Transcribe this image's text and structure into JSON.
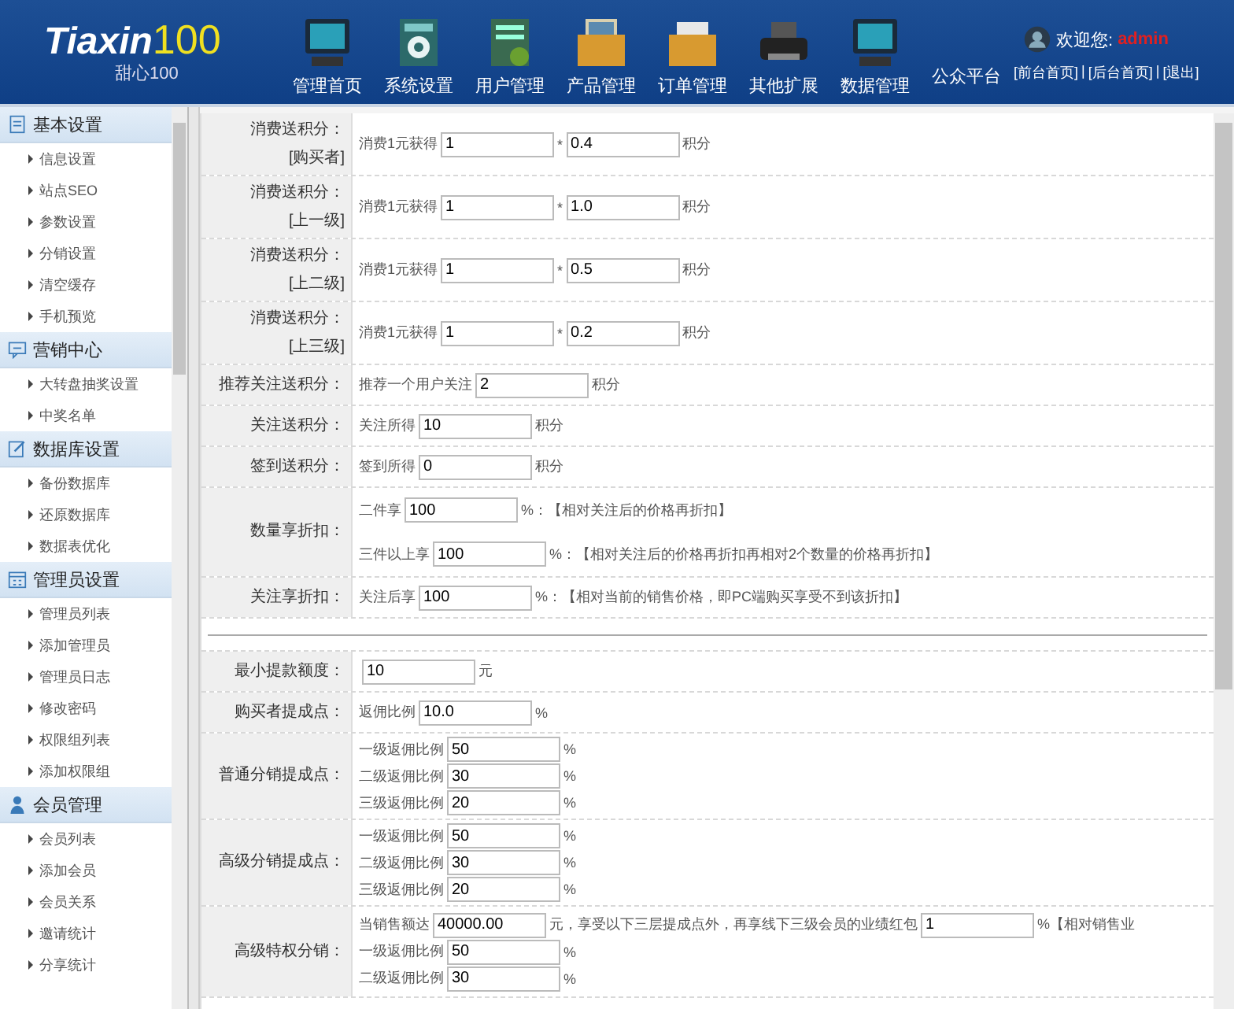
{
  "header": {
    "logo": {
      "name": "Tiaxin",
      "number": "100",
      "subtitle": "甜心100"
    },
    "nav": [
      {
        "label": "管理首页"
      },
      {
        "label": "系统设置"
      },
      {
        "label": "用户管理"
      },
      {
        "label": "产品管理"
      },
      {
        "label": "订单管理"
      },
      {
        "label": "其他扩展"
      },
      {
        "label": "数据管理"
      },
      {
        "label": "公众平台"
      }
    ],
    "welcome": {
      "label": "欢迎您:",
      "user": "admin"
    },
    "links": [
      {
        "label": "[前台首页]",
        "sep": "|"
      },
      {
        "label": "[后台首页]",
        "sep": "|"
      },
      {
        "label": "[退出]"
      }
    ]
  },
  "sidebar": [
    {
      "title": "基本设置",
      "items": [
        "信息设置",
        "站点SEO",
        "参数设置",
        "分销设置",
        "清空缓存",
        "手机预览"
      ]
    },
    {
      "title": "营销中心",
      "items": [
        "大转盘抽奖设置",
        "中奖名单"
      ]
    },
    {
      "title": "数据库设置",
      "items": [
        "备份数据库",
        "还原数据库",
        "数据表优化"
      ]
    },
    {
      "title": "管理员设置",
      "items": [
        "管理员列表",
        "添加管理员",
        "管理员日志",
        "修改密码",
        "权限组列表",
        "添加权限组"
      ]
    },
    {
      "title": "会员管理",
      "items": [
        "会员列表",
        "添加会员",
        "会员关系",
        "邀请统计",
        "分享统计"
      ]
    }
  ],
  "form": [
    {
      "kind": "tall",
      "label": [
        "消费送积分：",
        "[购买者]"
      ],
      "lines": [
        [
          {
            "kind": "text",
            "text": "消费1元获得"
          },
          {
            "kind": "input",
            "value": "1"
          },
          {
            "kind": "text",
            "text": "*"
          },
          {
            "kind": "input",
            "value": "0.4"
          },
          {
            "kind": "text",
            "text": "积分"
          }
        ]
      ]
    },
    {
      "kind": "tall",
      "label": [
        "消费送积分：",
        "[上一级]"
      ],
      "lines": [
        [
          {
            "kind": "text",
            "text": "消费1元获得"
          },
          {
            "kind": "input",
            "value": "1"
          },
          {
            "kind": "text",
            "text": "*"
          },
          {
            "kind": "input",
            "value": "1.0"
          },
          {
            "kind": "text",
            "text": "积分"
          }
        ]
      ]
    },
    {
      "kind": "tall",
      "label": [
        "消费送积分：",
        "[上二级]"
      ],
      "lines": [
        [
          {
            "kind": "text",
            "text": "消费1元获得"
          },
          {
            "kind": "input",
            "value": "1"
          },
          {
            "kind": "text",
            "text": "*"
          },
          {
            "kind": "input",
            "value": "0.5"
          },
          {
            "kind": "text",
            "text": "积分"
          }
        ]
      ]
    },
    {
      "kind": "tall",
      "label": [
        "消费送积分：",
        "[上三级]"
      ],
      "lines": [
        [
          {
            "kind": "text",
            "text": "消费1元获得"
          },
          {
            "kind": "input",
            "value": "1"
          },
          {
            "kind": "text",
            "text": "*"
          },
          {
            "kind": "input",
            "value": "0.2"
          },
          {
            "kind": "text",
            "text": "积分"
          }
        ]
      ]
    },
    {
      "kind": "single",
      "label": [
        "推荐关注送积分："
      ],
      "lines": [
        [
          {
            "kind": "text",
            "text": "推荐一个用户关注"
          },
          {
            "kind": "input",
            "value": "2"
          },
          {
            "kind": "text",
            "text": "积分"
          }
        ]
      ]
    },
    {
      "kind": "single",
      "label": [
        "关注送积分："
      ],
      "lines": [
        [
          {
            "kind": "text",
            "text": "关注所得"
          },
          {
            "kind": "input",
            "value": "10"
          },
          {
            "kind": "text",
            "text": "积分"
          }
        ]
      ]
    },
    {
      "kind": "single",
      "label": [
        "签到送积分："
      ],
      "lines": [
        [
          {
            "kind": "text",
            "text": "签到所得"
          },
          {
            "kind": "input",
            "value": "0"
          },
          {
            "kind": "text",
            "text": "积分"
          }
        ]
      ]
    },
    {
      "kind": "spread",
      "label": [
        "数量享折扣："
      ],
      "lines": [
        [
          {
            "kind": "text",
            "text": "二件享"
          },
          {
            "kind": "input",
            "value": "100"
          },
          {
            "kind": "text",
            "text": "%：【相对关注后的价格再折扣】"
          }
        ],
        [
          {
            "kind": "text",
            "text": "三件以上享"
          },
          {
            "kind": "input",
            "value": "100"
          },
          {
            "kind": "text",
            "text": "%：【相对关注后的价格再折扣再相对2个数量的价格再折扣】"
          }
        ]
      ]
    },
    {
      "kind": "single",
      "label": [
        "关注享折扣："
      ],
      "lines": [
        [
          {
            "kind": "text",
            "text": "关注后享"
          },
          {
            "kind": "input",
            "value": "100"
          },
          {
            "kind": "text",
            "text": "%：【相对当前的销售价格，即PC端购买享受不到该折扣】"
          }
        ]
      ]
    },
    {
      "kind": "divider"
    },
    {
      "kind": "single",
      "label": [
        "最小提款额度："
      ],
      "lines": [
        [
          {
            "kind": "input",
            "value": "10"
          },
          {
            "kind": "text",
            "text": "元"
          }
        ]
      ]
    },
    {
      "kind": "single",
      "label": [
        "购买者提成点："
      ],
      "lines": [
        [
          {
            "kind": "text",
            "text": "返佣比例"
          },
          {
            "kind": "input",
            "value": "10.0"
          },
          {
            "kind": "text",
            "text": "%"
          }
        ]
      ]
    },
    {
      "kind": "stack",
      "label": [
        "普通分销提成点："
      ],
      "lines": [
        [
          {
            "kind": "text",
            "text": "一级返佣比例"
          },
          {
            "kind": "input",
            "value": "50"
          },
          {
            "kind": "text",
            "text": "%"
          }
        ],
        [
          {
            "kind": "text",
            "text": "二级返佣比例"
          },
          {
            "kind": "input",
            "value": "30"
          },
          {
            "kind": "text",
            "text": "%"
          }
        ],
        [
          {
            "kind": "text",
            "text": "三级返佣比例"
          },
          {
            "kind": "input",
            "value": "20"
          },
          {
            "kind": "text",
            "text": "%"
          }
        ]
      ]
    },
    {
      "kind": "stack",
      "label": [
        "高级分销提成点："
      ],
      "lines": [
        [
          {
            "kind": "text",
            "text": "一级返佣比例"
          },
          {
            "kind": "input",
            "value": "50"
          },
          {
            "kind": "text",
            "text": "%"
          }
        ],
        [
          {
            "kind": "text",
            "text": "二级返佣比例"
          },
          {
            "kind": "input",
            "value": "30"
          },
          {
            "kind": "text",
            "text": "%"
          }
        ],
        [
          {
            "kind": "text",
            "text": "三级返佣比例"
          },
          {
            "kind": "input",
            "value": "20"
          },
          {
            "kind": "text",
            "text": "%"
          }
        ]
      ]
    },
    {
      "kind": "stack",
      "label": [
        "高级特权分销："
      ],
      "lines": [
        [
          {
            "kind": "text",
            "text": "当销售额达"
          },
          {
            "kind": "input",
            "value": "40000.00"
          },
          {
            "kind": "text",
            "text": "元，享受以下三层提成点外，再享线下三级会员的业绩红包"
          },
          {
            "kind": "input",
            "value": "1"
          },
          {
            "kind": "text",
            "text": "%【相对销售业"
          }
        ],
        [
          {
            "kind": "text",
            "text": "一级返佣比例"
          },
          {
            "kind": "input",
            "value": "50"
          },
          {
            "kind": "text",
            "text": "%"
          }
        ],
        [
          {
            "kind": "text",
            "text": "二级返佣比例"
          },
          {
            "kind": "input",
            "value": "30"
          },
          {
            "kind": "text",
            "text": "%"
          }
        ]
      ]
    }
  ]
}
